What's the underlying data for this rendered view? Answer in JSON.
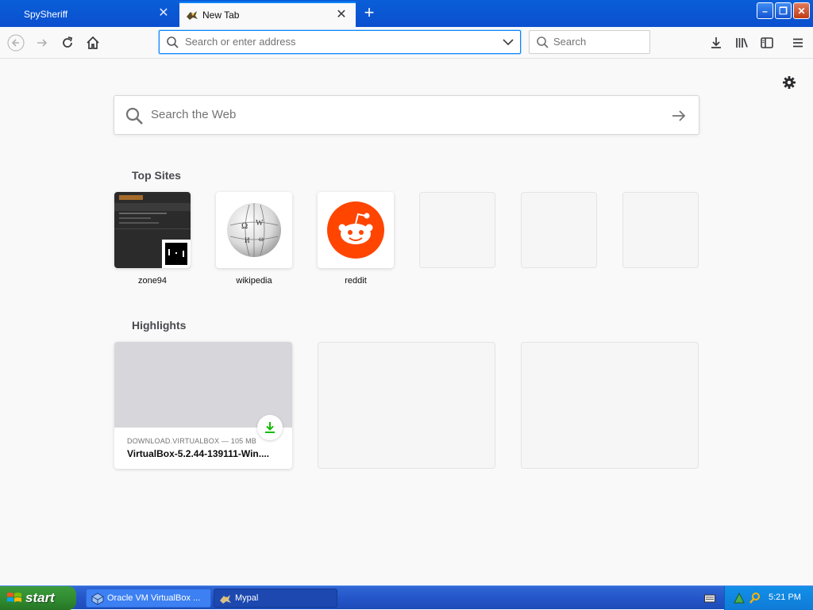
{
  "tabs": [
    {
      "title": "SpySheriff",
      "active": false
    },
    {
      "title": "New Tab",
      "active": true
    }
  ],
  "urlbar": {
    "placeholder": "Search or enter address"
  },
  "searchbar": {
    "placeholder": "Search"
  },
  "content": {
    "websearch_placeholder": "Search the Web",
    "top_sites_title": "Top Sites",
    "top_sites": [
      {
        "label": "zone94"
      },
      {
        "label": "wikipedia"
      },
      {
        "label": "reddit"
      }
    ],
    "highlights_title": "Highlights",
    "highlights": [
      {
        "source": "DOWNLOAD.VIRTUALBOX — 105 MB",
        "title": "VirtualBox-5.2.44-139111-Win...."
      }
    ]
  },
  "taskbar": {
    "start_label": "start",
    "tasks": [
      {
        "label": "Oracle VM VirtualBox ..."
      },
      {
        "label": "Mypal"
      }
    ],
    "clock": "5:21 PM"
  },
  "colors": {
    "accent": "#0a84ff",
    "reddit": "#ff4500",
    "download_green": "#12bc00"
  }
}
